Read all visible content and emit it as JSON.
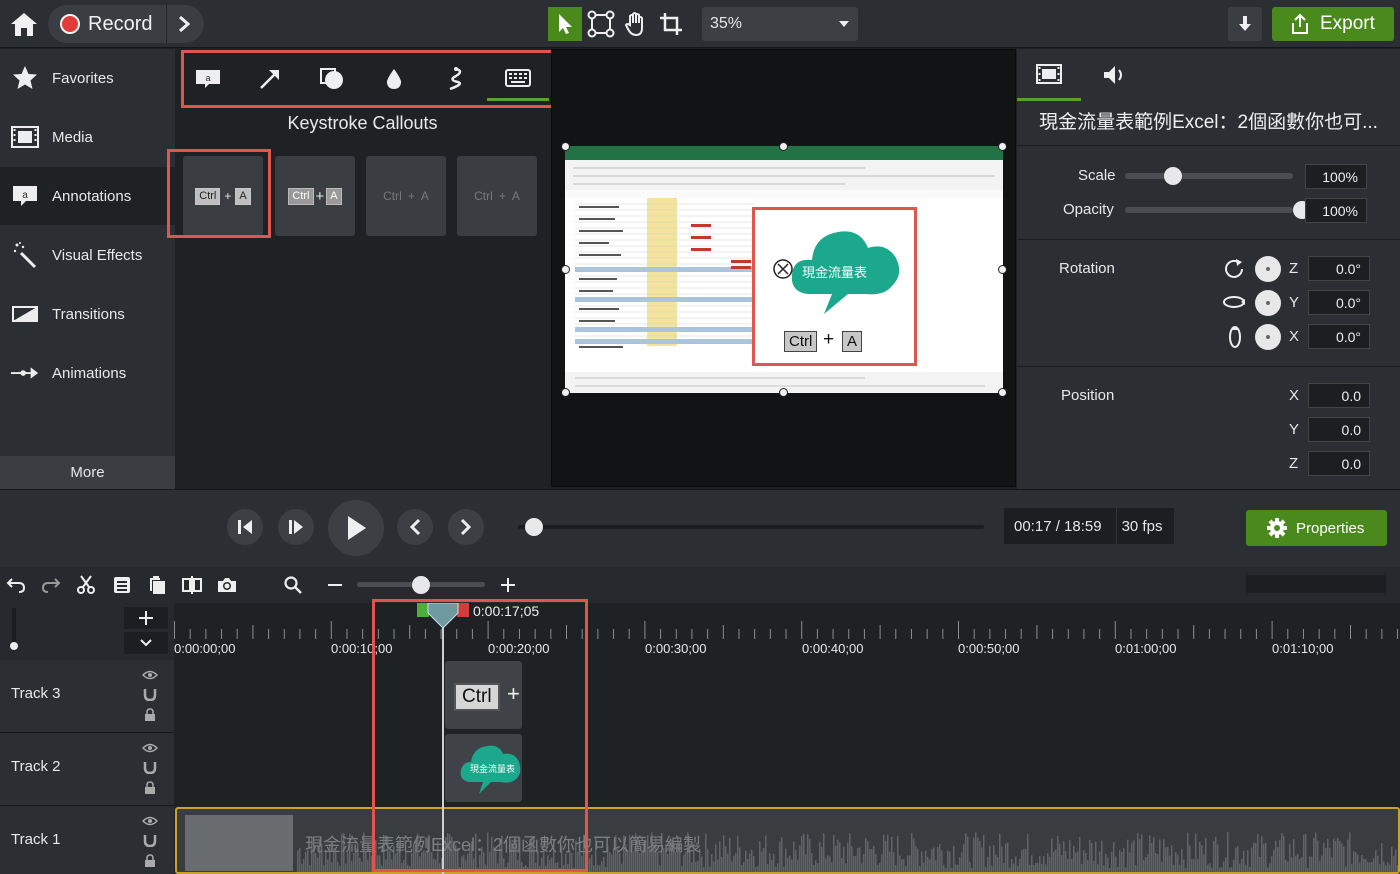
{
  "topbar": {
    "record_label": "Record",
    "zoom_value": "35%",
    "export_label": "Export",
    "tools": [
      "select-icon",
      "transform-icon",
      "hand-icon",
      "crop-icon"
    ]
  },
  "sidebar": {
    "items": [
      {
        "label": "Favorites",
        "icon": "star-icon"
      },
      {
        "label": "Media",
        "icon": "film-icon"
      },
      {
        "label": "Annotations",
        "icon": "callout-icon"
      },
      {
        "label": "Visual Effects",
        "icon": "wand-icon"
      },
      {
        "label": "Transitions",
        "icon": "transition-icon"
      },
      {
        "label": "Animations",
        "icon": "animation-icon"
      }
    ],
    "more_label": "More"
  },
  "annotations": {
    "title": "Keystroke Callouts",
    "tabs": [
      "callout-icon",
      "arrow-icon",
      "shape-icon",
      "blur-icon",
      "sketch-icon",
      "keyboard-icon"
    ],
    "cards": [
      {
        "key1": "Ctrl",
        "plus": "+",
        "key2": "A"
      },
      {
        "key1": "Ctrl",
        "plus": "+",
        "key2": "A"
      },
      {
        "key1": "Ctrl",
        "plus": "+",
        "key2": "A"
      },
      {
        "key1": "Ctrl",
        "plus": "+",
        "key2": "A"
      }
    ]
  },
  "canvas": {
    "callout_text": "現金流量表",
    "key1": "Ctrl",
    "plus": "+",
    "key2": "A"
  },
  "properties": {
    "title": "現金流量表範例Excel：2個函數你也可...",
    "scale_label": "Scale",
    "scale_value": "100%",
    "scale_fraction": 0.23,
    "opacity_label": "Opacity",
    "opacity_value": "100%",
    "opacity_fraction": 1.0,
    "rotation_label": "Rotation",
    "rotation": [
      {
        "axis": "Z",
        "value": "0.0°"
      },
      {
        "axis": "Y",
        "value": "0.0°"
      },
      {
        "axis": "X",
        "value": "0.0°"
      }
    ],
    "position_label": "Position",
    "position": [
      {
        "axis": "X",
        "value": "0.0"
      },
      {
        "axis": "Y",
        "value": "0.0"
      },
      {
        "axis": "Z",
        "value": "0.0"
      }
    ]
  },
  "playback": {
    "time": "00:17 / 18:59",
    "fps": "30 fps",
    "properties_label": "Properties",
    "progress_fraction": 0.015
  },
  "timeline": {
    "playhead_time": "0:00:17;05",
    "ticks": [
      "0:00:00;00",
      "0:00:10;00",
      "0:00:20;00",
      "0:00:30;00",
      "0:00:40;00",
      "0:00:50;00",
      "0:01:00;00",
      "0:01:10;00"
    ],
    "tracks": [
      {
        "name": "Track 3"
      },
      {
        "name": "Track 2"
      },
      {
        "name": "Track 1"
      }
    ],
    "clip_key": "Ctrl",
    "clip_plus": "+",
    "clip_callout": "現金流量表",
    "track1_title": "現金流量表範例Excel：2個函數你也可以簡易編製"
  }
}
